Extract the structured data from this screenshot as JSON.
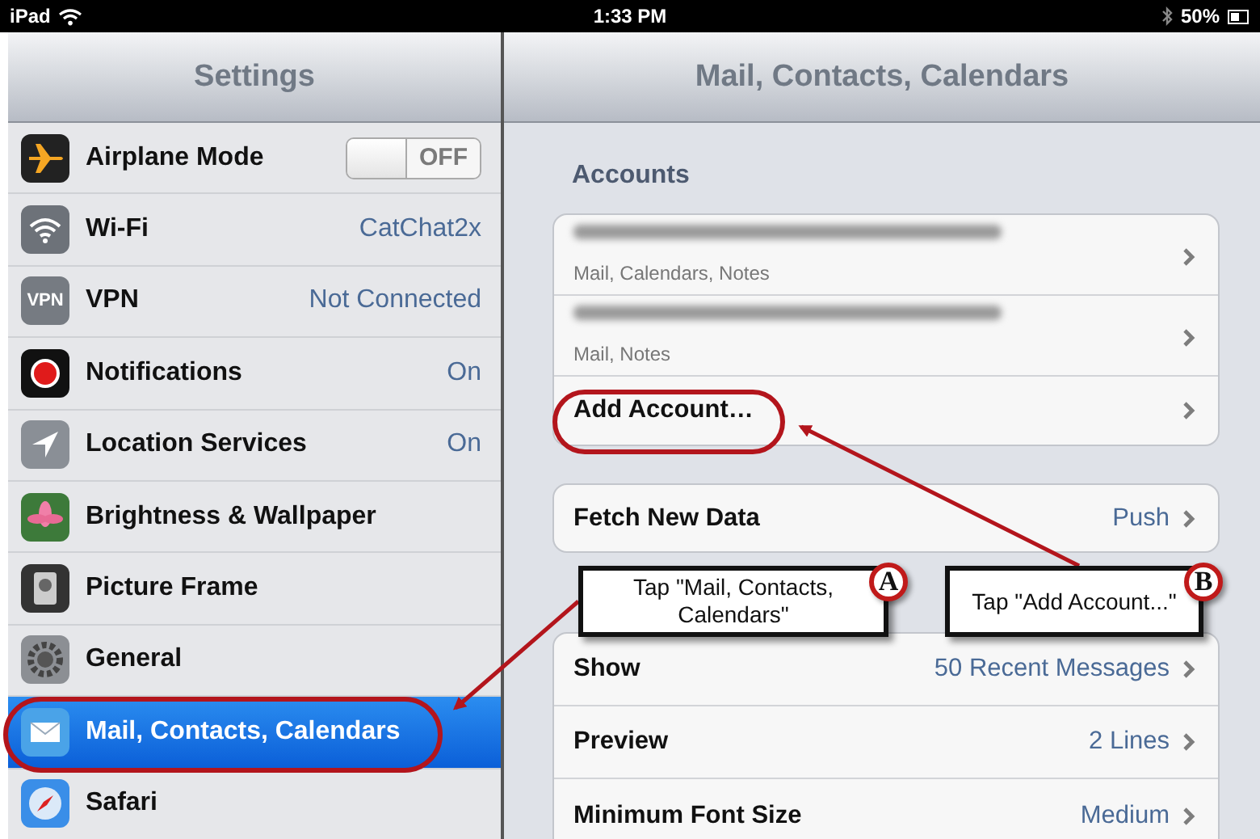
{
  "status_bar": {
    "carrier": "iPad",
    "time": "1:33 PM",
    "battery": "50%"
  },
  "sidebar": {
    "title": "Settings",
    "items": [
      {
        "label": "Airplane Mode",
        "kind": "toggle",
        "on": false,
        "toggle_label": "OFF",
        "selected": false
      },
      {
        "label": "Wi-Fi",
        "kind": "detail",
        "value": "CatChat2x",
        "selected": false
      },
      {
        "label": "VPN",
        "kind": "detail",
        "value": "Not Connected",
        "icon_text": "VPN",
        "selected": false
      },
      {
        "label": "Notifications",
        "kind": "detail",
        "value": "On",
        "selected": false
      },
      {
        "label": "Location Services",
        "kind": "detail",
        "value": "On",
        "selected": false
      },
      {
        "label": "Brightness & Wallpaper",
        "kind": "plain",
        "selected": false
      },
      {
        "label": "Picture Frame",
        "kind": "plain",
        "selected": false
      },
      {
        "label": "General",
        "kind": "plain",
        "selected": false
      },
      {
        "label": "Mail, Contacts, Calendars",
        "kind": "plain",
        "selected": true
      },
      {
        "label": "Safari",
        "kind": "plain",
        "selected": false
      }
    ]
  },
  "detail": {
    "title": "Mail, Contacts, Calendars",
    "accounts_header": "Accounts",
    "accounts": [
      {
        "subtitle": "Mail, Calendars, Notes"
      },
      {
        "subtitle": "Mail, Notes"
      }
    ],
    "add_account": "Add Account…",
    "fetch": {
      "label": "Fetch New Data",
      "value": "Push"
    },
    "mail_rows": [
      {
        "label": "Show",
        "value": "50 Recent Messages"
      },
      {
        "label": "Preview",
        "value": "2 Lines"
      },
      {
        "label": "Minimum Font Size",
        "value": "Medium"
      }
    ]
  },
  "annotations": [
    {
      "badge": "A",
      "text": "Tap \"Mail, Contacts, Calendars\""
    },
    {
      "badge": "B",
      "text": "Tap \"Add Account...\""
    }
  ]
}
